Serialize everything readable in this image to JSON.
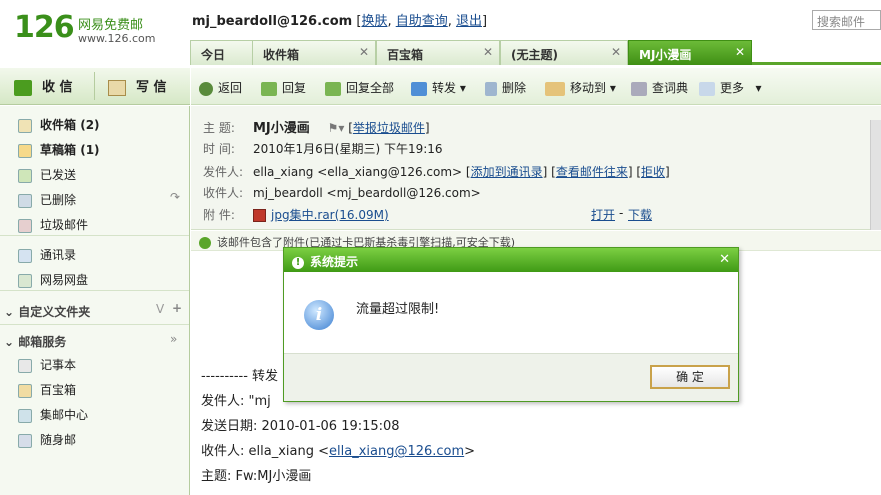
{
  "logo": {
    "num": "126",
    "cn": "网易免费邮",
    "url": "www.126.com"
  },
  "user": {
    "email": "mj_beardoll@126.com",
    "links": [
      "换肤",
      "自助查询",
      "退出"
    ]
  },
  "search": {
    "placeholder": "搜索邮件"
  },
  "tabs": [
    "今日",
    "收件箱",
    "百宝箱",
    "(无主题)",
    "MJ小漫画"
  ],
  "left": {
    "receive": "收 信",
    "write": "写 信"
  },
  "folders": [
    {
      "label": "收件箱",
      "count": "(2)"
    },
    {
      "label": "草稿箱",
      "count": "(1)"
    },
    {
      "label": "已发送"
    },
    {
      "label": "已删除"
    },
    {
      "label": "垃圾邮件"
    },
    {
      "label": "通讯录"
    },
    {
      "label": "网易网盘"
    }
  ],
  "sections": {
    "custom": "自定义文件夹",
    "services": "邮箱服务"
  },
  "services": [
    "记事本",
    "百宝箱",
    "集邮中心",
    "随身邮"
  ],
  "toolbar": [
    "返回",
    "回复",
    "回复全部",
    "转发",
    "删除",
    "移动到",
    "查词典",
    "更多"
  ],
  "mail": {
    "subject_label": "主 题:",
    "subject": "MJ小漫画",
    "report": "举报垃圾邮件",
    "time_label": "时 间:",
    "time": "2010年1月6日(星期三) 下午19:16",
    "from_label": "发件人:",
    "from": "ella_xiang <ella_xiang@126.com>",
    "from_links": [
      "添加到通讯录",
      "查看邮件往来",
      "拒收"
    ],
    "to_label": "收件人:",
    "to": "mj_beardoll <mj_beardoll@126.com>",
    "att_label": "附 件:",
    "attachment": "jpg集中.rar(16.09M)",
    "open": "打开",
    "download": "下载"
  },
  "notice": "该邮件包含了附件(已通过卡巴斯基杀毒引擎扫描,可安全下载)",
  "body": {
    "fwd": "---------- 转发",
    "from": "发件人: \"mj",
    "date": "发送日期: 2010-01-06 19:15:08",
    "to_prefix": "收件人: ella_xiang <",
    "to_link": "ella_xiang@126.com",
    "to_suffix": ">",
    "subject": "主题: Fw:MJ小漫画"
  },
  "dialog": {
    "title": "系统提示",
    "message": "流量超过限制!",
    "ok": "确 定"
  }
}
